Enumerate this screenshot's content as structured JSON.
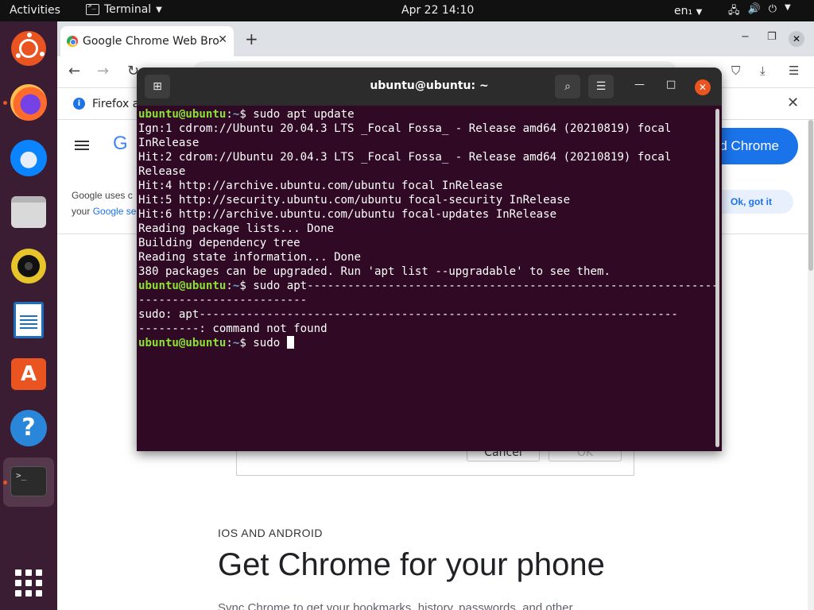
{
  "topbar": {
    "activities": "Activities",
    "app_name": "Terminal",
    "clock": "Apr 22  14:10",
    "lang": "en₁"
  },
  "dock": {
    "apps": [
      "ubuntu-logo",
      "firefox",
      "thunderbird",
      "files",
      "rhythmbox",
      "libreoffice-writer",
      "software-center",
      "help",
      "terminal",
      "show-applications"
    ],
    "store_glyph": "A",
    "help_glyph": "?",
    "term_glyph": ">_"
  },
  "chrome": {
    "tab_title": "Google Chrome Web Bro",
    "infobar_text": "Firefox a",
    "logo_text": "G",
    "download_button": "d Chrome",
    "cookie_line1": "Google uses c",
    "cookie_line2_prefix": "your ",
    "cookie_line2_link": "Google se",
    "ok_button": "Ok, got it",
    "dialog_cancel": "Cancel",
    "dialog_ok": "OK",
    "section_label": "IOS AND ANDROID",
    "phone_title": "Get Chrome for your phone",
    "sync_text": "Sync Chrome to get your bookmarks, history, passwords, and other"
  },
  "terminal": {
    "title": "ubuntu@ubuntu: ~",
    "prompt_user": "ubuntu@ubuntu",
    "prompt_sep": ":",
    "prompt_path": "~",
    "lines": [
      {
        "type": "prompt",
        "cmd": "$ sudo apt update"
      },
      {
        "type": "out",
        "text": "Ign:1 cdrom://Ubuntu 20.04.3 LTS _Focal Fossa_ - Release amd64 (20210819) focal"
      },
      {
        "type": "out",
        "text": "InRelease"
      },
      {
        "type": "out",
        "text": "Hit:2 cdrom://Ubuntu 20.04.3 LTS _Focal Fossa_ - Release amd64 (20210819) focal"
      },
      {
        "type": "out",
        "text": "Release"
      },
      {
        "type": "out",
        "text": "Hit:4 http://archive.ubuntu.com/ubuntu focal InRelease"
      },
      {
        "type": "out",
        "text": "Hit:5 http://security.ubuntu.com/ubuntu focal-security InRelease"
      },
      {
        "type": "out",
        "text": "Hit:6 http://archive.ubuntu.com/ubuntu focal-updates InRelease"
      },
      {
        "type": "out",
        "text": "Reading package lists... Done"
      },
      {
        "type": "out",
        "text": "Building dependency tree"
      },
      {
        "type": "out",
        "text": "Reading state information... Done"
      },
      {
        "type": "out",
        "text": "380 packages can be upgraded. Run 'apt list --upgradable' to see them."
      },
      {
        "type": "prompt",
        "cmd": "$ sudo apt-------------------------------------------------------------"
      },
      {
        "type": "out",
        "text": "-------------------------"
      },
      {
        "type": "out",
        "text": "sudo: apt-----------------------------------------------------------------------"
      },
      {
        "type": "out",
        "text": "---------: command not found"
      },
      {
        "type": "prompt",
        "cmd": "$ sudo ",
        "cursor": true
      }
    ]
  },
  "colors": {
    "terminal_bg": "#300a24",
    "prompt_user": "#8ae234",
    "prompt_path": "#729fcf",
    "ubuntu_orange": "#e95420",
    "dock_bg": "#3a1d33",
    "chrome_blue": "#1a73e8"
  }
}
